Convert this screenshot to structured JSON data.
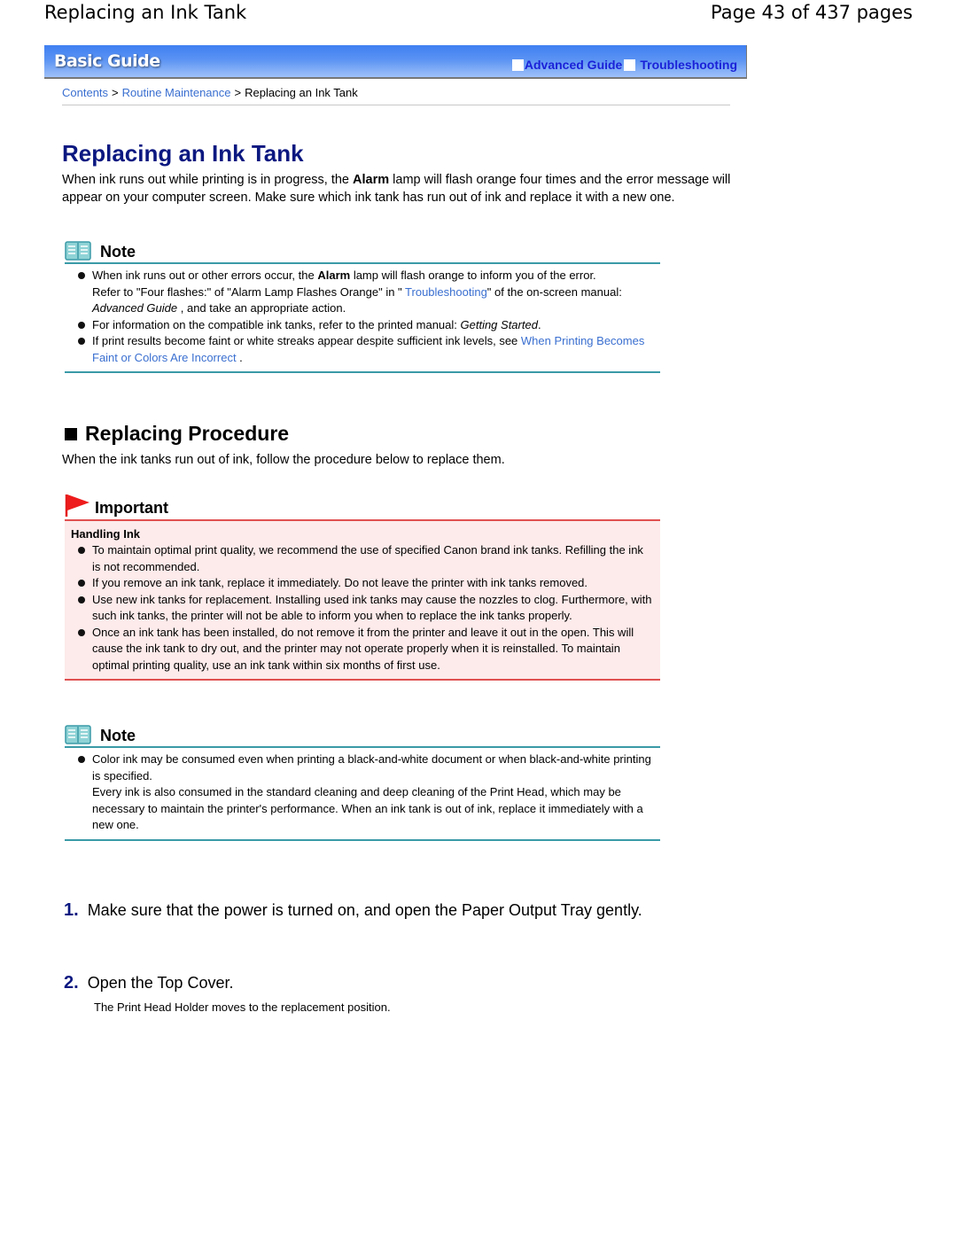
{
  "page_header": {
    "title": "Replacing an Ink Tank",
    "page_count": "Page 43 of 437 pages"
  },
  "banner": {
    "logo": "Basic Guide",
    "links": [
      {
        "label": "Advanced Guide",
        "icon": "white-square-icon"
      },
      {
        "label": "Troubleshooting",
        "icon": "white-square-icon"
      }
    ],
    "colors": {
      "gradient_top": "#3f7ff2",
      "gradient_bottom": "#9fc1f9",
      "link": "#1a22d8"
    }
  },
  "breadcrumb": {
    "items": [
      {
        "label": "Contents",
        "link": true
      },
      {
        "label": "Routine Maintenance",
        "link": true
      },
      {
        "label": "Replacing an Ink Tank",
        "link": false
      }
    ],
    "separator": ">"
  },
  "main": {
    "title": "Replacing an Ink Tank",
    "intro": {
      "before": "When ink runs out while printing is in progress, the ",
      "bold": "Alarm",
      "after": " lamp will flash orange four times and the error message will appear on your computer screen. Make sure which ink tank has run out of ink and replace it with a new one."
    },
    "note1": {
      "label": "Note",
      "icon": "book-icon",
      "items": [
        {
          "p1_before": "When ink runs out or other errors occur, the ",
          "p1_bold": "Alarm",
          "p1_after": " lamp will flash orange to inform you of the error.",
          "p2_before": "Refer to \"Four flashes:\" of \"Alarm Lamp Flashes Orange\" in \" ",
          "p2_link": "Troubleshooting",
          "p2_mid": "\" of the on-screen manual: ",
          "p2_italic": "Advanced Guide",
          "p2_after": " , and take an appropriate action."
        },
        {
          "before": "For information on the compatible ink tanks, refer to the printed manual: ",
          "italic": "Getting Started",
          "after": "."
        },
        {
          "before": "If print results become faint or white streaks appear despite sufficient ink levels, see ",
          "link": "When Printing Becomes Faint or Colors Are Incorrect",
          "after": " ."
        }
      ]
    },
    "procedure": {
      "title": "Replacing Procedure",
      "intro": "When the ink tanks run out of ink, follow the procedure below to replace them."
    },
    "important": {
      "label": "Important",
      "icon": "red-flag-icon",
      "subtitle": "Handling Ink",
      "items": [
        "To maintain optimal print quality, we recommend the use of specified Canon brand ink tanks. Refilling the ink is not recommended.",
        "If you remove an ink tank, replace it immediately. Do not leave the printer with ink tanks removed.",
        "Use new ink tanks for replacement. Installing used ink tanks may cause the nozzles to clog. Furthermore, with such ink tanks, the printer will not be able to inform you when to replace the ink tanks properly.",
        "Once an ink tank has been installed, do not remove it from the printer and leave it out in the open. This will cause the ink tank to dry out, and the printer may not operate properly when it is reinstalled. To maintain optimal printing quality, use an ink tank within six months of first use."
      ]
    },
    "note2": {
      "label": "Note",
      "icon": "book-icon",
      "items": [
        {
          "p1": "Color ink may be consumed even when printing a black-and-white document or when black-and-white printing is specified.",
          "p2": "Every ink is also consumed in the standard cleaning and deep cleaning of the Print Head, which may be necessary to maintain the printer's performance. When an ink tank is out of ink, replace it immediately with a new one."
        }
      ]
    },
    "steps": [
      {
        "number": "1.",
        "text": "Make sure that the power is turned on, and open the Paper Output Tray gently."
      },
      {
        "number": "2.",
        "text": "Open the Top Cover.",
        "sub": "The Print Head Holder moves to the replacement position."
      }
    ]
  }
}
